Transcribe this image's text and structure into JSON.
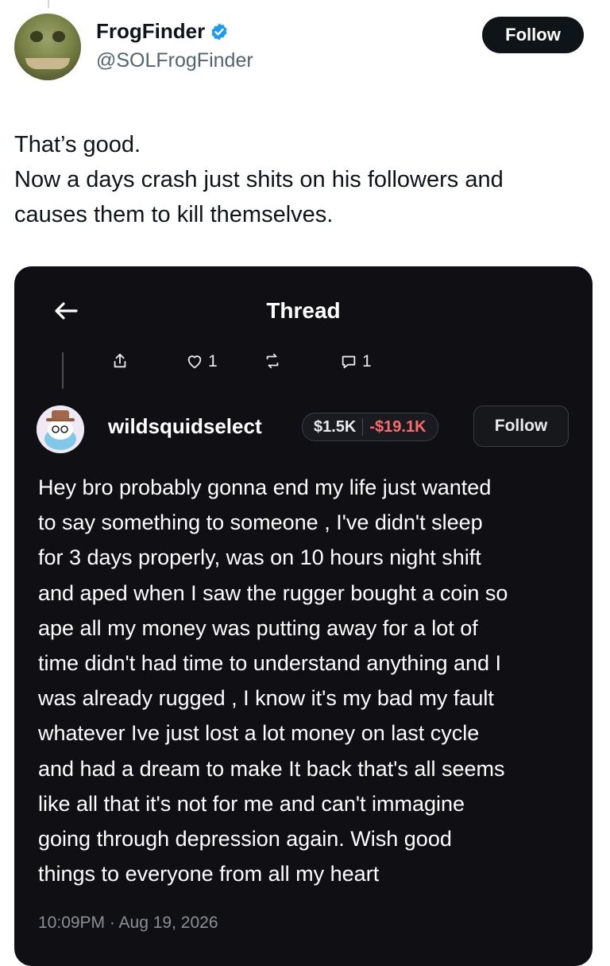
{
  "tweet": {
    "author": {
      "name": "FrogFinder",
      "handle": "@SOLFrogFinder",
      "verified": true
    },
    "follow_label": "Follow",
    "text_lines": [
      "That’s good.",
      "Now a days crash just shits on his followers and",
      "causes them to kill themselves."
    ]
  },
  "embed": {
    "header_title": "Thread",
    "actions": {
      "likes": "1",
      "comments": "1"
    },
    "post": {
      "username": "wildsquidselect",
      "pnl_gain": "$1.5K",
      "pnl_loss": "-$19.1K",
      "follow_label": "Follow",
      "body_lines": [
        "Hey bro probably gonna end my life just wanted",
        "to say something to someone , I've didn't sleep",
        "for 3 days properly, was on 10 hours night shift",
        "and aped when I saw the rugger bought a coin so",
        "ape all my money was putting away for a lot of",
        "time didn't had time to understand anything and I",
        "was already rugged , I know it's my bad my fault",
        "whatever Ive just lost a lot money on last cycle",
        "and had a dream to make It back that's all seems",
        "like all that it's not for me and can't immagine",
        "going through depression again. Wish good",
        "things to everyone from all my heart"
      ],
      "timestamp": "10:09PM · Aug 19, 2026"
    }
  },
  "colors": {
    "follow_bg": "#0f1419",
    "verified_blue": "#1d9bf0",
    "embed_bg": "#101014",
    "loss_red": "#ff6b6b",
    "muted_text": "#536471"
  },
  "icons": [
    "back-arrow-icon",
    "share-icon",
    "heart-icon",
    "repost-icon",
    "comment-icon",
    "verified-badge-icon"
  ]
}
